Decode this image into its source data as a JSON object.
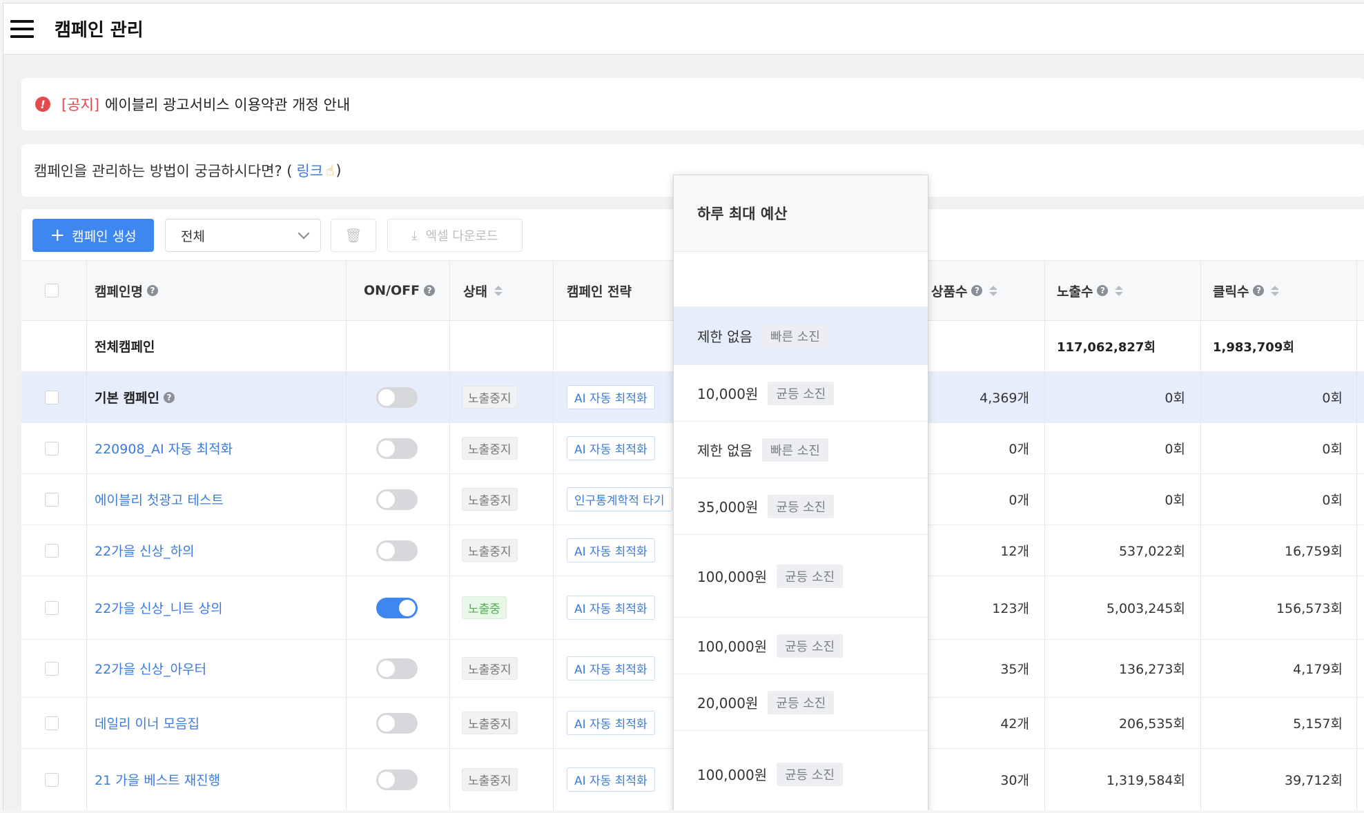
{
  "header": {
    "title": "캠페인 관리"
  },
  "notice": {
    "tag": "[공지]",
    "text": "에이블리 광고서비스 이용약관 개정 안내"
  },
  "help": {
    "text": "캠페인을 관리하는 방법이 궁금하시다면? (",
    "link": "링크",
    "close": ")"
  },
  "toolbar": {
    "create_label": "캠페인 생성",
    "filter_value": "전체",
    "excel_label": "엑셀 다운로드"
  },
  "columns": {
    "name": "캠페인명",
    "onoff": "ON/OFF",
    "status": "상태",
    "strategy": "캠페인 전략",
    "products": "상품수",
    "impressions": "노출수",
    "clicks": "클릭수"
  },
  "total": {
    "label": "전체캠페인",
    "impressions": "117,062,827회",
    "clicks": "1,983,709회"
  },
  "rows": [
    {
      "name": "기본 캠페인",
      "on": false,
      "status": "노출중지",
      "strategy": "AI 자동 최적화",
      "products": "4,369개",
      "impressions": "0회",
      "clicks": "0회"
    },
    {
      "name": "220908_AI 자동 최적화",
      "on": false,
      "status": "노출중지",
      "strategy": "AI 자동 최적화",
      "products": "0개",
      "impressions": "0회",
      "clicks": "0회"
    },
    {
      "name": "에이블리 첫광고 테스트",
      "on": false,
      "status": "노출중지",
      "strategy": "인구통계학적 타기",
      "products": "0개",
      "impressions": "0회",
      "clicks": "0회"
    },
    {
      "name": "22가을 신상_하의",
      "on": false,
      "status": "노출중지",
      "strategy": "AI 자동 최적화",
      "products": "12개",
      "impressions": "537,022회",
      "clicks": "16,759회"
    },
    {
      "name": "22가을 신상_니트 상의",
      "on": true,
      "status": "노출중",
      "strategy": "AI 자동 최적화",
      "products": "123개",
      "impressions": "5,003,245회",
      "clicks": "156,573회"
    },
    {
      "name": "22가을 신상_아우터",
      "on": false,
      "status": "노출중지",
      "strategy": "AI 자동 최적화",
      "products": "35개",
      "impressions": "136,273회",
      "clicks": "4,179회"
    },
    {
      "name": "데일리 이너 모음집",
      "on": false,
      "status": "노출중지",
      "strategy": "AI 자동 최적화",
      "products": "42개",
      "impressions": "206,535회",
      "clicks": "5,157회"
    },
    {
      "name": "21 가을 베스트 재진행",
      "on": false,
      "status": "노출중지",
      "strategy": "AI 자동 최적화",
      "products": "30개",
      "impressions": "1,319,584회",
      "clicks": "39,712회"
    }
  ],
  "popup": {
    "title": "하루 최대 예산",
    "items": [
      {
        "amount": "제한 없음",
        "mode": "빠른 소진"
      },
      {
        "amount": "10,000원",
        "mode": "균등 소진"
      },
      {
        "amount": "제한 없음",
        "mode": "빠른 소진"
      },
      {
        "amount": "35,000원",
        "mode": "균등 소진"
      },
      {
        "amount": "100,000원",
        "mode": "균등 소진"
      },
      {
        "amount": "100,000원",
        "mode": "균등 소진"
      },
      {
        "amount": "20,000원",
        "mode": "균등 소진"
      },
      {
        "amount": "100,000원",
        "mode": "균등 소진"
      }
    ]
  }
}
